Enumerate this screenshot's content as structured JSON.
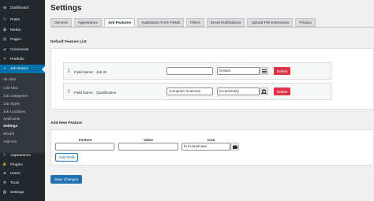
{
  "sidebar": {
    "items": [
      {
        "label": "Dashboard",
        "icon": "dashboard-icon",
        "glyph": "◉"
      },
      {
        "label": "Posts",
        "icon": "pin-icon",
        "glyph": "✎"
      },
      {
        "label": "Media",
        "icon": "media-icon",
        "glyph": "▣"
      },
      {
        "label": "Pages",
        "icon": "page-icon",
        "glyph": "▤"
      },
      {
        "label": "Comments",
        "icon": "comment-icon",
        "glyph": "▰"
      },
      {
        "label": "Portfolio",
        "icon": "portfolio-icon",
        "glyph": "✦"
      },
      {
        "label": "Job Board",
        "icon": "briefcase-icon",
        "glyph": "▪"
      }
    ],
    "submenu": [
      "All Jobs",
      "Add New",
      "Job Categories",
      "Job Types",
      "Job Locations",
      "Applicants",
      "Settings",
      "Wizard",
      "Add-ons"
    ],
    "current_sub": "Settings",
    "bottom": [
      {
        "label": "Appearance",
        "icon": "appearance-icon",
        "glyph": "✎"
      },
      {
        "label": "Plugins",
        "icon": "plugin-icon",
        "glyph": "⚡"
      },
      {
        "label": "Users",
        "icon": "users-icon",
        "glyph": "☻"
      },
      {
        "label": "Tools",
        "icon": "tools-icon",
        "glyph": "✚"
      },
      {
        "label": "Settings",
        "icon": "settings-icon",
        "glyph": "▦"
      }
    ]
  },
  "page": {
    "title": "Settings"
  },
  "tabs": [
    "General",
    "Appearance",
    "Job Features",
    "Application Form Fields",
    "Filters",
    "Email Notifications",
    "Upload File Extensions",
    "Privacy"
  ],
  "active_tab": "Job Features",
  "default_section": {
    "heading": "Default Feature List",
    "rows": [
      {
        "field_name_label": "Field Name:",
        "field_name": "Job Id",
        "value": "",
        "icon": "fa-bars",
        "delete": "Delete"
      },
      {
        "field_name_label": "Field Name:",
        "field_name": "Qualification",
        "value": "Computer Sciences",
        "icon": "fa-university",
        "delete": "Delete"
      }
    ]
  },
  "add_section": {
    "heading": "Add New Feature",
    "col_feature": "Feature",
    "col_value": "Value",
    "col_icon": "Icon",
    "feature": "",
    "value": "",
    "icon": "fa fa-briefcase",
    "add_button": "Add Field"
  },
  "save_button": "Save Changes",
  "colors": {
    "sidebar": "#23282d",
    "active": "#0073aa",
    "primary": "#2271b1",
    "danger": "#dc3545"
  }
}
